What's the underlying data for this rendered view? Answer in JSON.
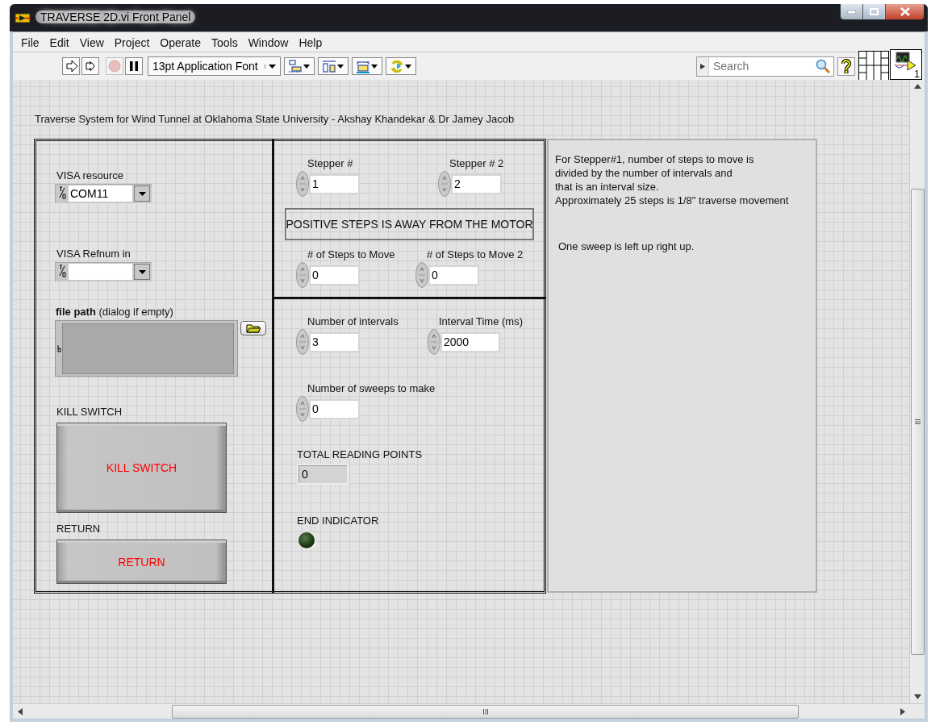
{
  "window": {
    "title": "TRAVERSE 2D.vi Front Panel"
  },
  "menu": [
    "File",
    "Edit",
    "View",
    "Project",
    "Operate",
    "Tools",
    "Window",
    "Help"
  ],
  "toolbar": {
    "buttons": [
      {
        "kind": "run",
        "disabled": false
      },
      {
        "kind": "run-continuously",
        "disabled": false
      },
      {
        "kind": "abort",
        "disabled": true
      },
      {
        "kind": "pause",
        "disabled": false
      }
    ],
    "font": "13pt Application Font",
    "tools": [
      {
        "kind": "align"
      },
      {
        "kind": "distribute"
      },
      {
        "kind": "resize"
      },
      {
        "kind": "reorder"
      }
    ],
    "search": {
      "placeholder": "Search"
    },
    "vi_icon_number": "1"
  },
  "panel": {
    "heading": "Traverse System for Wind Tunnel at Oklahoma State University - Akshay Khandekar & Dr Jamey Jacob",
    "controls": [
      {
        "kind": "visa",
        "label": "VISA resource",
        "value": "COM11"
      },
      {
        "kind": "visa",
        "label": "VISA Refnum in"
      },
      {
        "kind": "path",
        "label": "**file path** (dialog if empty)"
      },
      {
        "kind": "button",
        "label": "KILL SWITCH",
        "text": "KILL SWITCH"
      },
      {
        "kind": "button",
        "label": "RETURN",
        "text": "RETURN"
      },
      {
        "kind": "numeric",
        "label": "Stepper #",
        "value": "1"
      },
      {
        "kind": "numeric",
        "label": "Stepper # 2",
        "value": "2"
      },
      {
        "kind": "decoration",
        "text": "POSITIVE STEPS IS AWAY FROM THE MOTOR"
      },
      {
        "kind": "numeric",
        "label": "# of Steps to Move",
        "value": "0"
      },
      {
        "kind": "numeric",
        "label": "# of Steps to Move 2",
        "value": "0"
      },
      {
        "kind": "numeric",
        "label": "Number of intervals",
        "value": "3"
      },
      {
        "kind": "numeric",
        "label": "Interval Time (ms)",
        "value": "2000"
      },
      {
        "kind": "numeric",
        "label": "Number of sweeps to make",
        "value": "0"
      },
      {
        "kind": "indicator",
        "label": "TOTAL READING POINTS",
        "value": "0"
      },
      {
        "kind": "led",
        "label": "END INDICATOR",
        "on": false
      }
    ],
    "notes": [
      {
        "lines": [
          "For Stepper#1, number of steps to move is",
          "divided by the number of intervals and",
          "that is an interval size.",
          "Approximately 25 steps is 1/8\" traverse movement"
        ]
      },
      {
        "lines": [
          "One sweep is left up right up."
        ]
      }
    ]
  }
}
